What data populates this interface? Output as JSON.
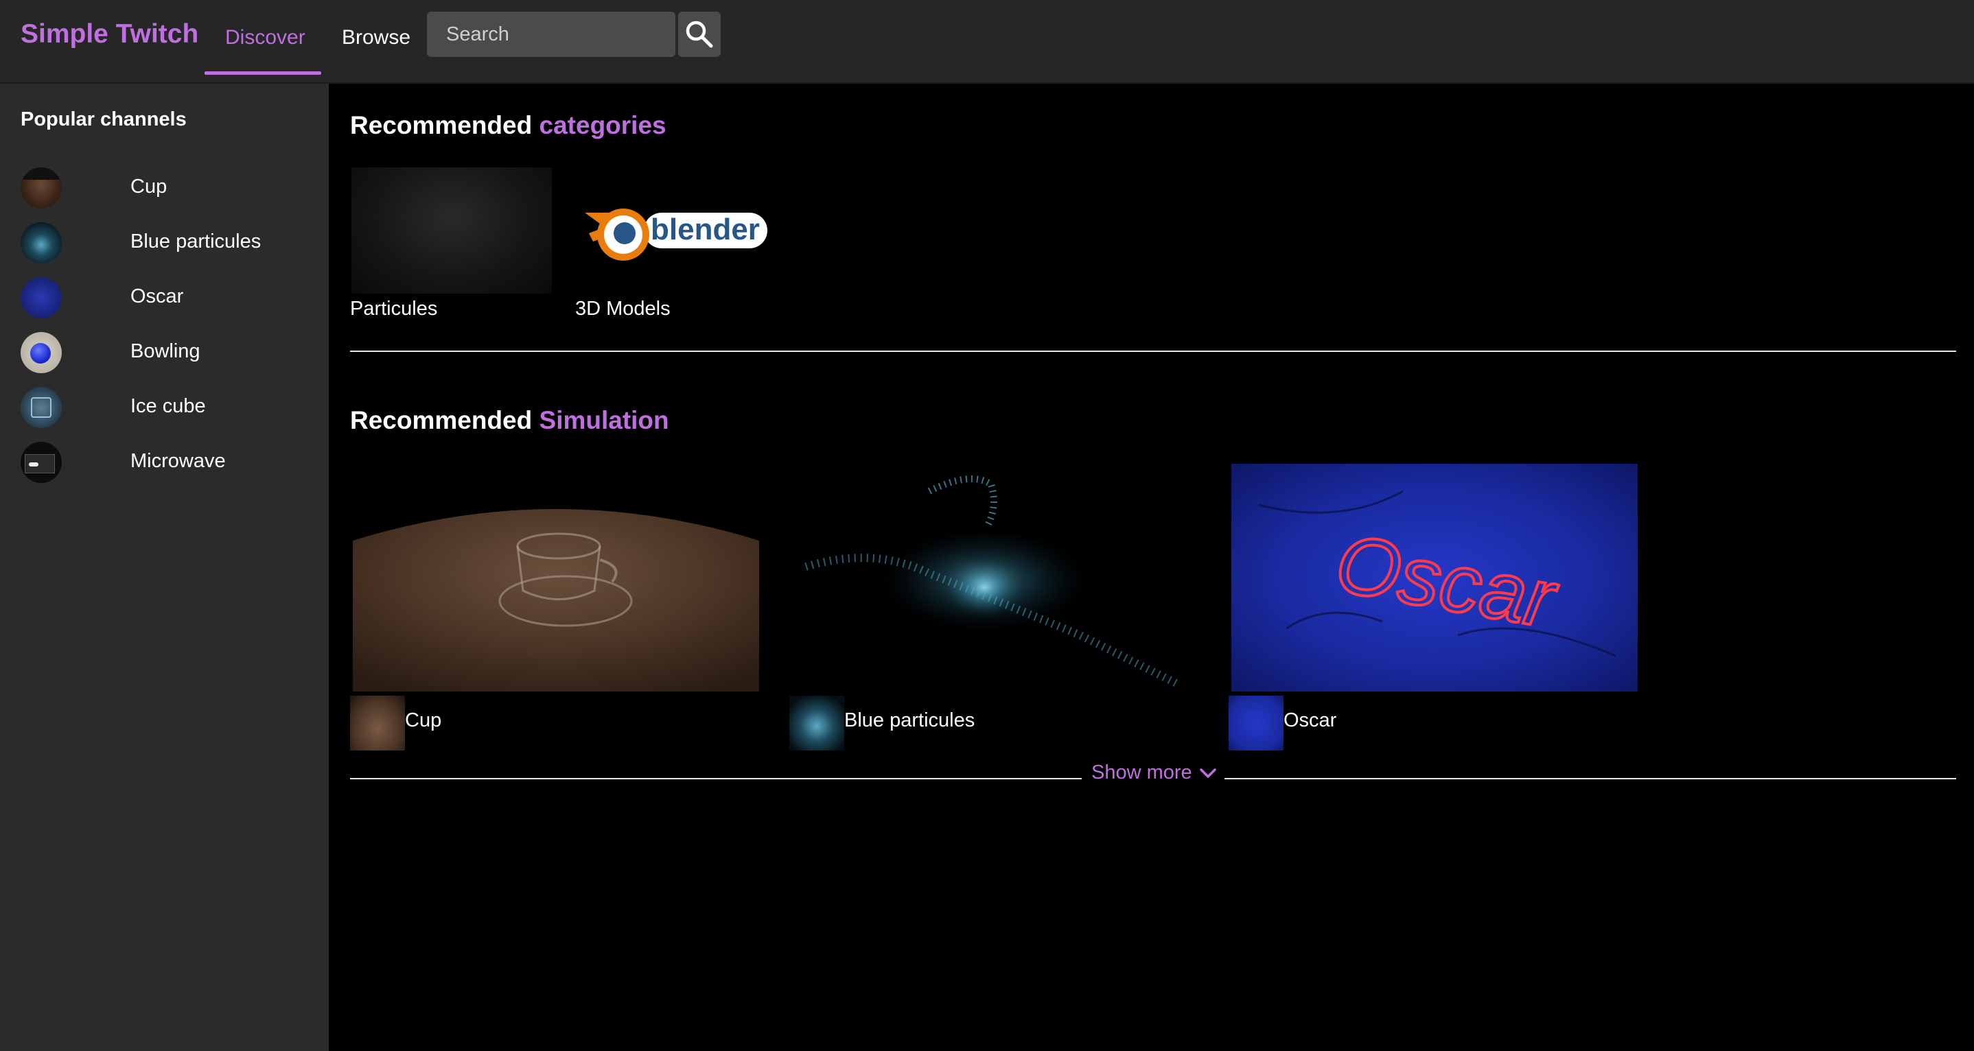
{
  "header": {
    "brand": "Simple Twitch",
    "tabs": [
      {
        "label": "Discover",
        "active": true
      },
      {
        "label": "Browse",
        "active": false
      }
    ],
    "search": {
      "placeholder": "Search",
      "value": ""
    },
    "search_button_icon": "search-icon"
  },
  "sidebar": {
    "title": "Popular channels",
    "channels": [
      {
        "label": "Cup"
      },
      {
        "label": "Blue particules"
      },
      {
        "label": "Oscar"
      },
      {
        "label": "Bowling"
      },
      {
        "label": "Ice cube"
      },
      {
        "label": "Microwave"
      }
    ]
  },
  "categories_section": {
    "title_prefix": "Recommended",
    "title_accent": "categories",
    "items": [
      {
        "label": "Particules"
      },
      {
        "label": "3D Models",
        "logo_text": "blender"
      }
    ]
  },
  "simulation_section": {
    "title_prefix": "Recommended",
    "title_accent": "Simulation",
    "streams": [
      {
        "label": "Cup"
      },
      {
        "label": "Blue particules"
      },
      {
        "label": "Oscar",
        "thumbnail_text": "Oscar"
      }
    ],
    "show_more": "Show more"
  },
  "colors": {
    "accent": "#bf6fe0",
    "header_bg": "#262626",
    "sidebar_bg": "#2b2b2b",
    "main_bg": "#000000"
  }
}
